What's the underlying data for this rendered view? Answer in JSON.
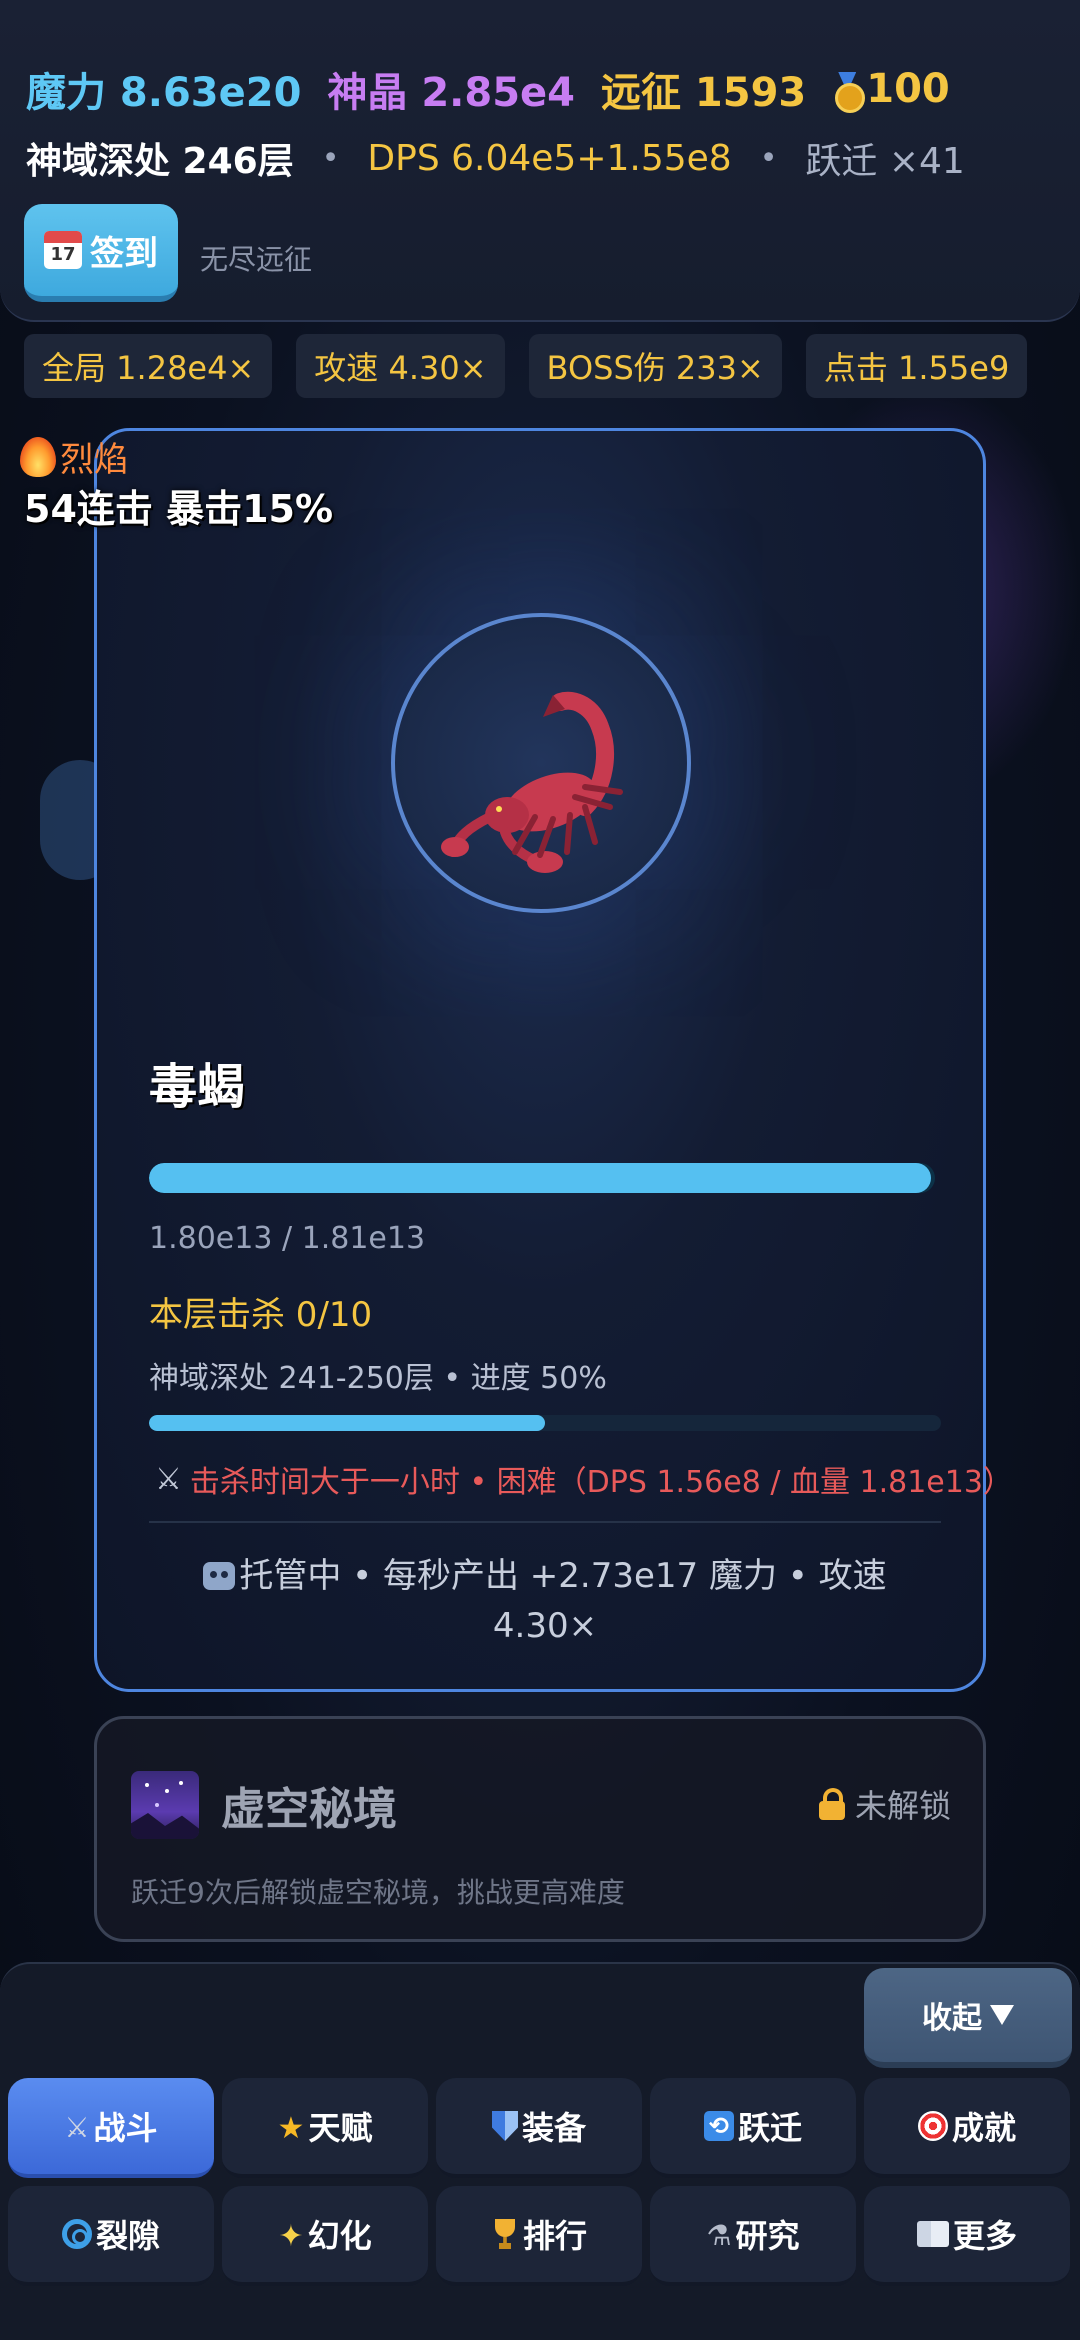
{
  "header": {
    "mana_label": "魔力 8.63e20",
    "crystal_label": "神晶 2.85e4",
    "expedition_label": "远征 1593",
    "medal_value": "100",
    "floor_name": "神域深处 246层",
    "dps_label": "DPS 6.04e5+1.55e8",
    "transmigration_label": "跃迁 ×41",
    "checkin_label": "签到",
    "calendar_day": "17",
    "mode_label": "无尽远征"
  },
  "multipliers": [
    {
      "label": "全局 1.28e4×"
    },
    {
      "label": "攻速 4.30×"
    },
    {
      "label": "BOSS伤 233×"
    },
    {
      "label": "点击 1.55e9"
    }
  ],
  "combat_status": {
    "element": "烈焰",
    "combo": "54连击  暴击15%"
  },
  "monster": {
    "name": "毒蝎",
    "hp_text": "1.80e13 / 1.81e13",
    "hp_fraction": 0.995,
    "kills": "本层击杀 0/10",
    "range_text": "神域深处 241-250层 • 进度 50%",
    "progress_fraction": 0.5,
    "warning": "击杀时间大于一小时 • 困难（DPS 1.56e8 / 血量 1.81e13）",
    "auto_text": "托管中 • 每秒产出 +2.73e17 魔力 • 攻速 4.30×"
  },
  "void_realm": {
    "title": "虚空秘境",
    "lock_label": "未解锁",
    "description": "跃迁9次后解锁虚空秘境，挑战更高难度"
  },
  "bottom": {
    "collapse_label": "收起",
    "nav": [
      {
        "label": "战斗",
        "icon": "crossed-swords-icon",
        "active": true
      },
      {
        "label": "天赋",
        "icon": "star-icon",
        "active": false
      },
      {
        "label": "装备",
        "icon": "shield-icon",
        "active": false
      },
      {
        "label": "跃迁",
        "icon": "cycle-icon",
        "active": false
      },
      {
        "label": "成就",
        "icon": "target-icon",
        "active": false
      },
      {
        "label": "裂隙",
        "icon": "rift-icon",
        "active": false
      },
      {
        "label": "幻化",
        "icon": "sparkles-icon",
        "active": false
      },
      {
        "label": "排行",
        "icon": "trophy-icon",
        "active": false
      },
      {
        "label": "研究",
        "icon": "microscope-icon",
        "active": false
      },
      {
        "label": "更多",
        "icon": "book-icon",
        "active": false
      }
    ]
  },
  "colors": {
    "accent_blue": "#55c0f1",
    "gold": "#f4c542",
    "crystal_purple": "#c77df2",
    "warning_red": "#e85a5a",
    "active_tab": "#4a7ae6"
  }
}
